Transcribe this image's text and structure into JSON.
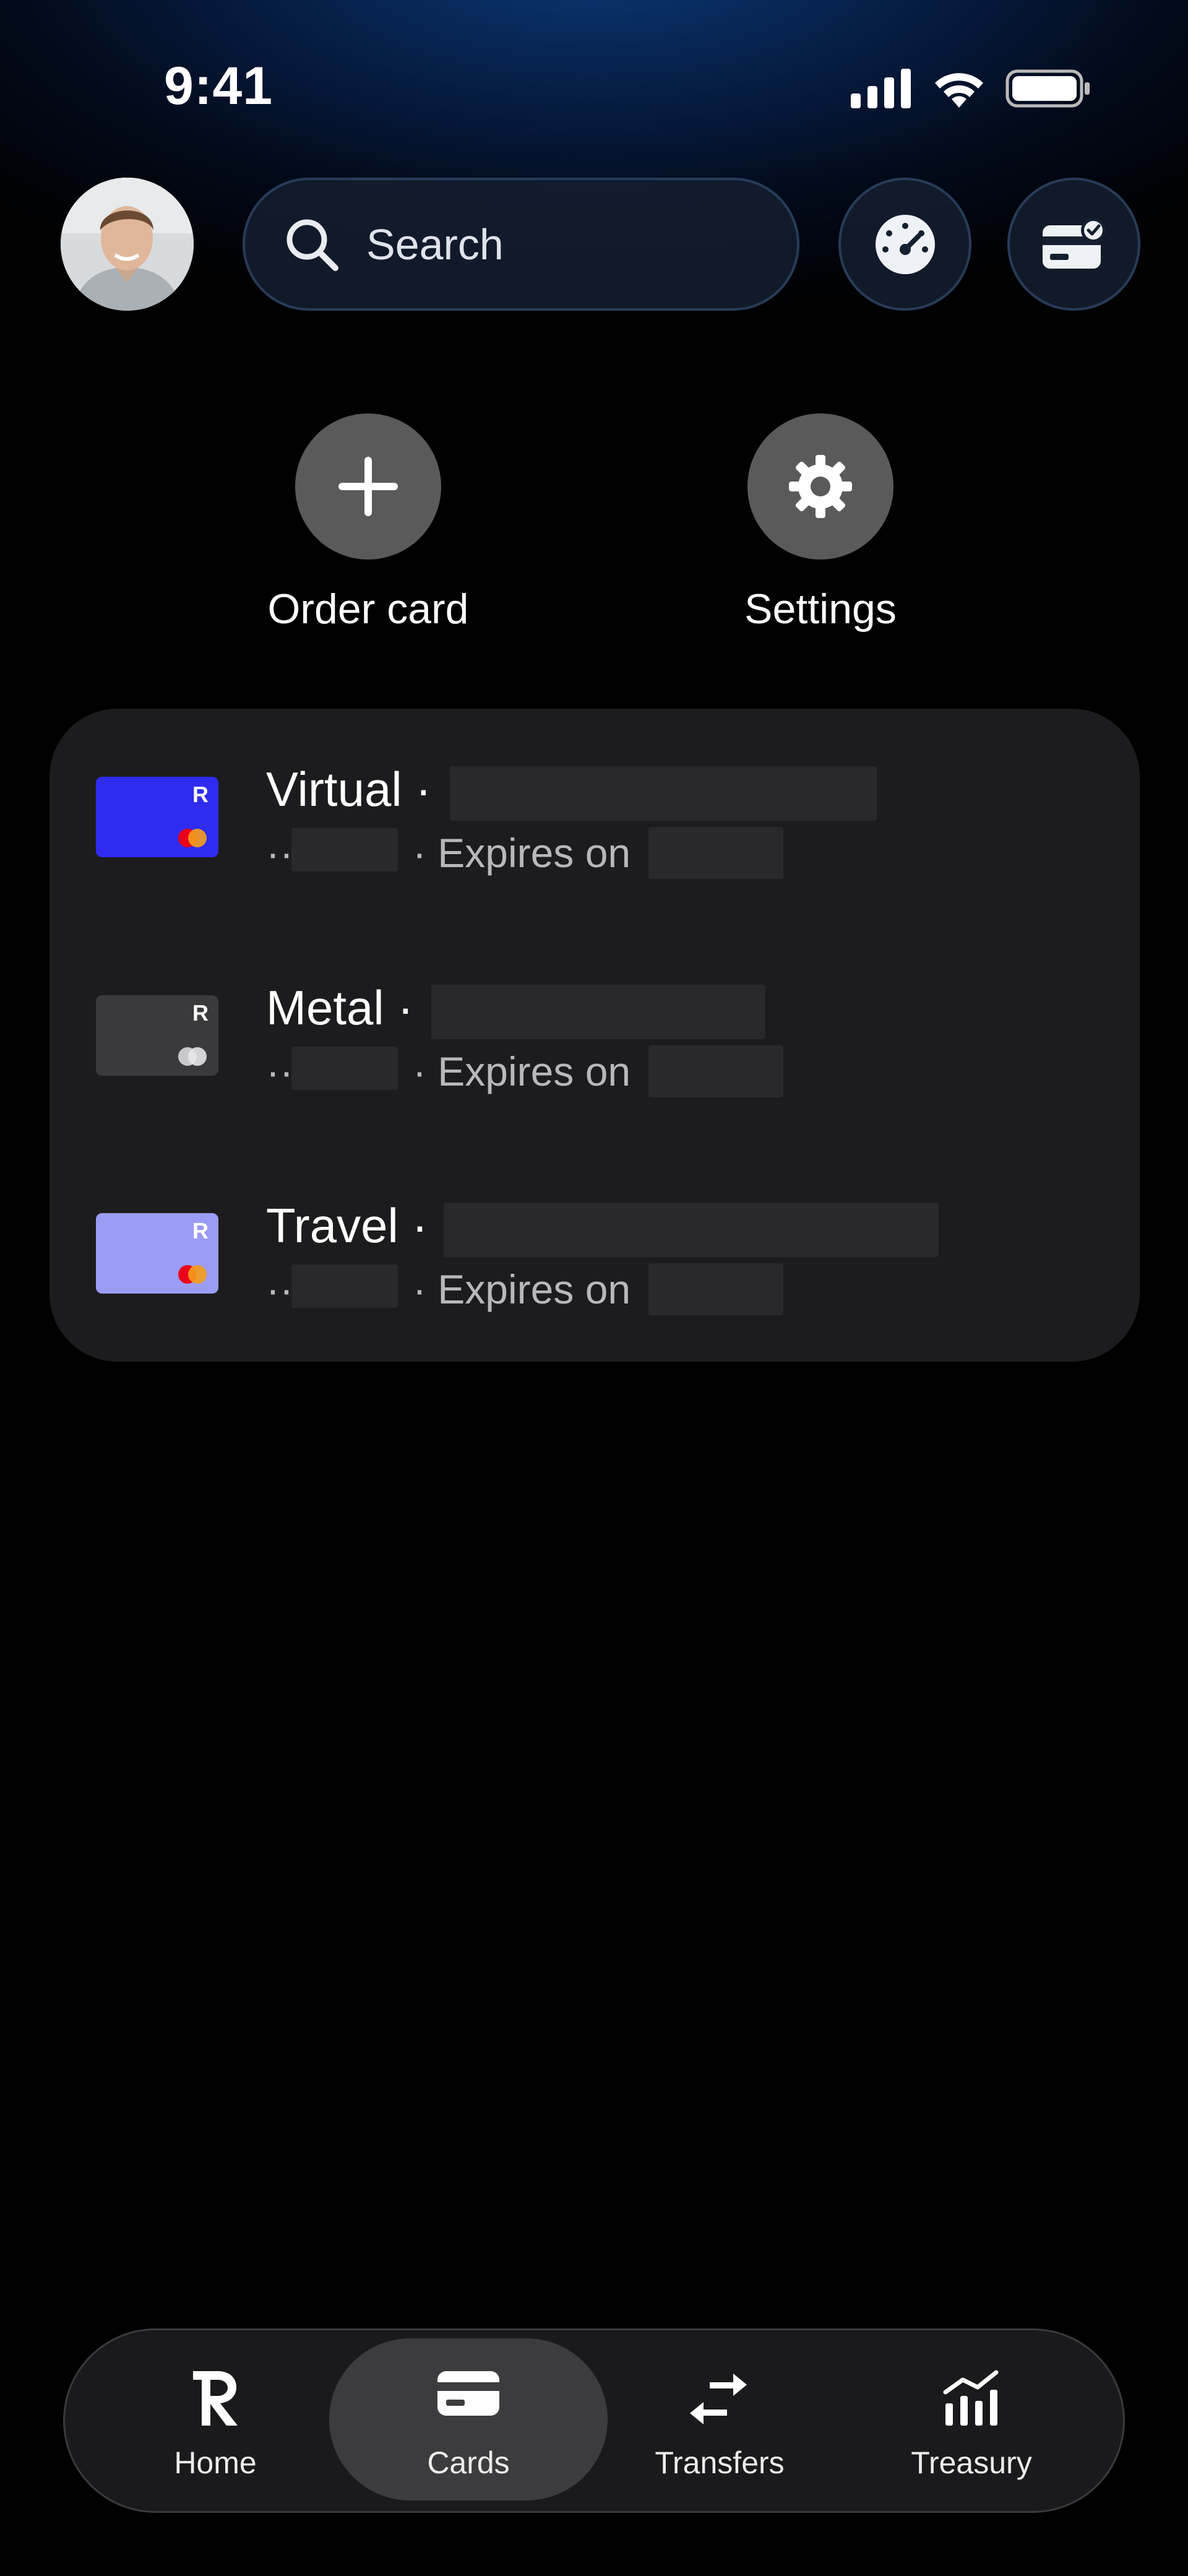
{
  "status_bar": {
    "time": "9:41"
  },
  "header": {
    "search": {
      "placeholder": "Search"
    }
  },
  "quick_actions": [
    {
      "label": "Order card",
      "icon": "plus-icon"
    },
    {
      "label": "Settings",
      "icon": "gear-icon"
    }
  ],
  "cards": [
    {
      "name": "Virtual ·",
      "masked_prefix": "··",
      "expires_text": "· Expires on",
      "card_color": "#2f2cf0",
      "network": "mastercard-color"
    },
    {
      "name": "Metal ·",
      "masked_prefix": "··",
      "expires_text": "· Expires on",
      "card_color": "#3a3a3c",
      "network": "mastercard-grey"
    },
    {
      "name": "Travel ·",
      "masked_prefix": "··",
      "expires_text": "· Expires on",
      "card_color": "#9b9cf6",
      "network": "mastercard-color"
    }
  ],
  "bottom_nav": [
    {
      "label": "Home",
      "icon": "revolut-logo-icon",
      "active": false
    },
    {
      "label": "Cards",
      "icon": "card-icon",
      "active": true
    },
    {
      "label": "Transfers",
      "icon": "transfer-arrows-icon",
      "active": false
    },
    {
      "label": "Treasury",
      "icon": "chart-bars-icon",
      "active": false
    }
  ],
  "colors": {
    "background": "#000000",
    "header_glow": "#0b3a78",
    "panel": "#1c1c1e",
    "action_circle": "#5a5a5a",
    "nav_active": "#3c3c3e"
  }
}
